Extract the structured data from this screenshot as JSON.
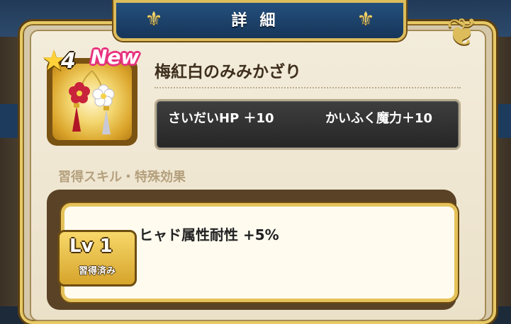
{
  "header": {
    "title": "詳細"
  },
  "item": {
    "rarity": "4",
    "badge": "New",
    "name": "梅紅白のみみかざり",
    "stats": [
      {
        "label": "さいだいHP ＋10"
      },
      {
        "label": "かいふく魔力＋10"
      }
    ]
  },
  "skills_section": {
    "header": "習得スキル・特殊効果",
    "skills": [
      {
        "level": "Lv 1",
        "status": "習得済み",
        "effect": "ヒャド属性耐性 +5%"
      }
    ]
  },
  "colors": {
    "title_plate": "#1f4570",
    "gold_border": "#e5c25a",
    "new_badge": "#e8337f",
    "stats_bg": "#2f2f2f"
  },
  "icons": {
    "title_ornament": "fleur-de-lis-icon",
    "rarity": "star-icon",
    "item": "earring-icon"
  }
}
